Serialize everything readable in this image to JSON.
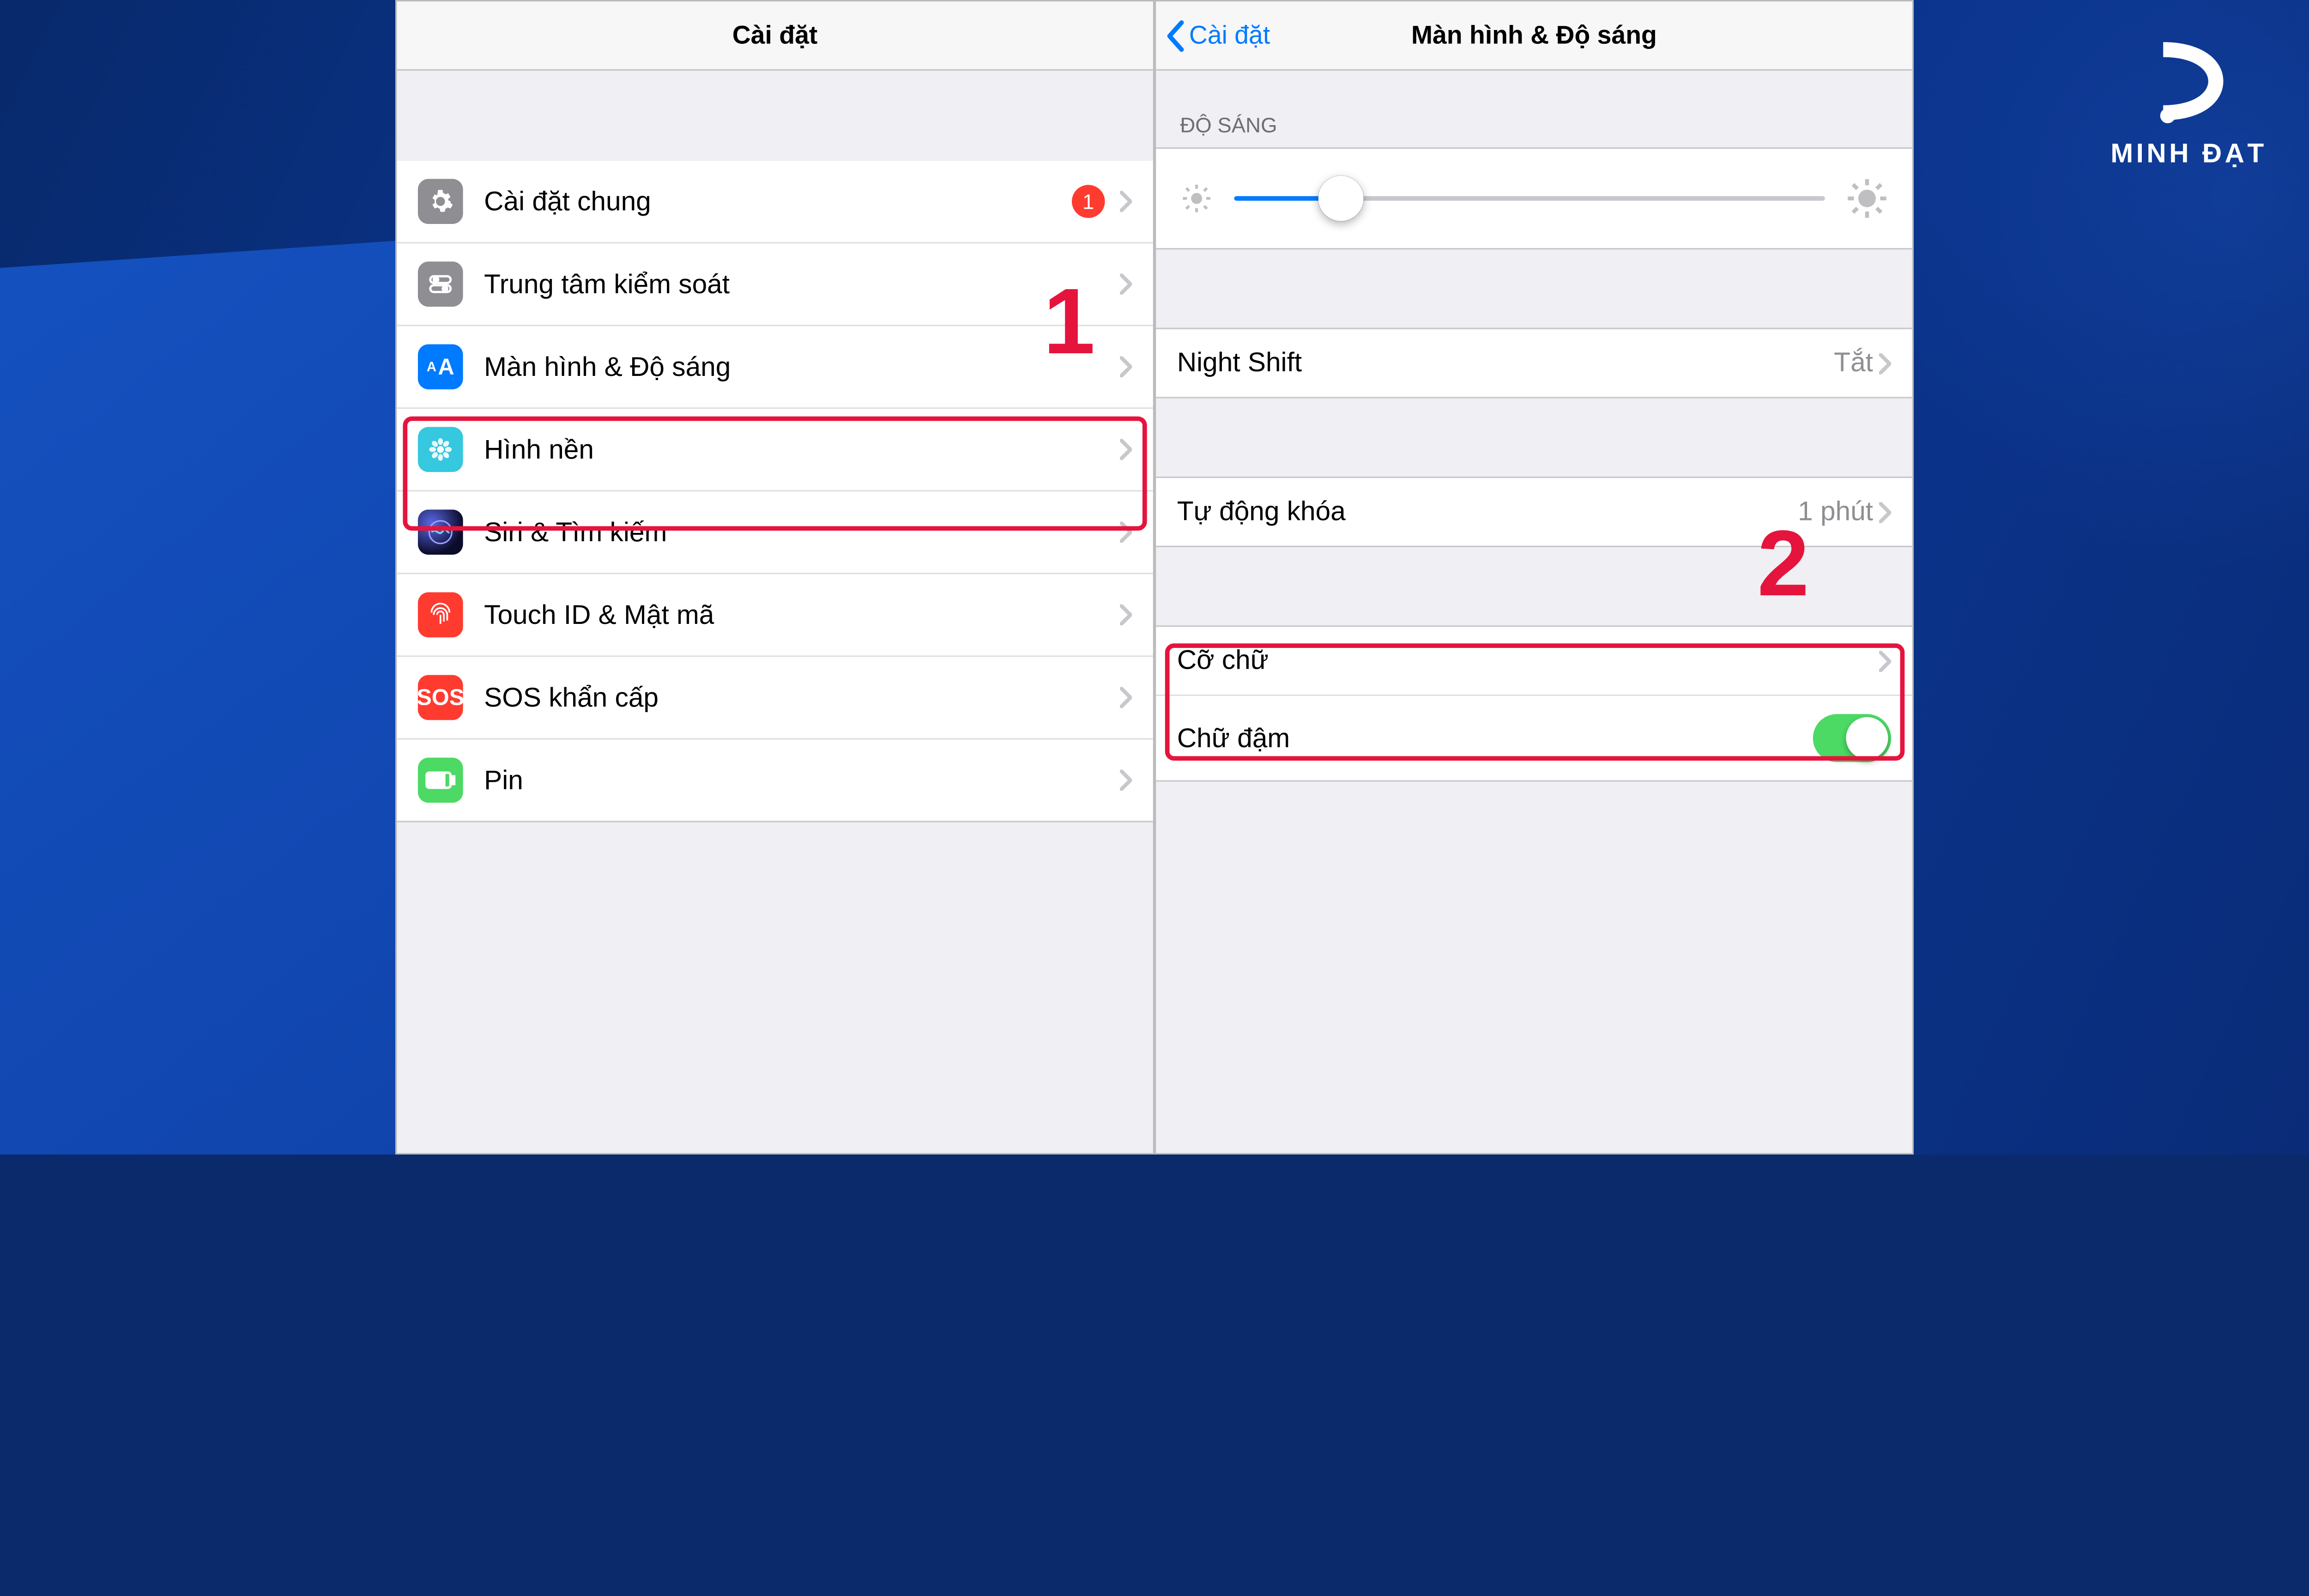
{
  "brand": {
    "name": "MINH ĐẠT"
  },
  "annotations": {
    "step1": "1",
    "step2": "2"
  },
  "screen1": {
    "title": "Cài đặt",
    "items": {
      "general": {
        "label": "Cài đặt chung",
        "badge": "1"
      },
      "control": {
        "label": "Trung tâm kiểm soát"
      },
      "display": {
        "label": "Màn hình & Độ sáng"
      },
      "wallpaper": {
        "label": "Hình nền"
      },
      "siri": {
        "label": "Siri & Tìm kiếm"
      },
      "touchid": {
        "label": "Touch ID & Mật mã"
      },
      "sos": {
        "label": "SOS khẩn cấp",
        "icon_text": "SOS"
      },
      "battery": {
        "label": "Pin"
      }
    }
  },
  "screen2": {
    "back": "Cài đặt",
    "title": "Màn hình & Độ sáng",
    "brightness_header": "ĐỘ SÁNG",
    "brightness_percent": 18,
    "night_shift": {
      "label": "Night Shift",
      "value": "Tắt"
    },
    "auto_lock": {
      "label": "Tự động khóa",
      "value": "1 phút"
    },
    "text_size": {
      "label": "Cỡ chữ"
    },
    "bold_text": {
      "label": "Chữ đậm",
      "on": true
    }
  }
}
